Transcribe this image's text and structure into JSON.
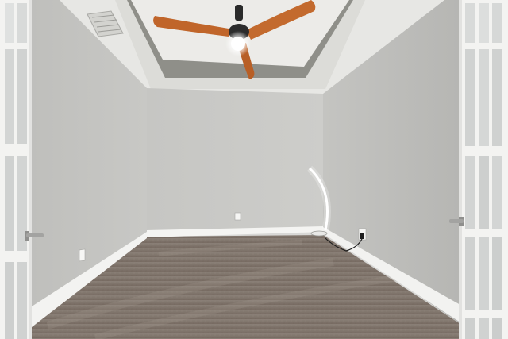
{
  "scene": {
    "subject": "empty-room",
    "colors": {
      "wall_back": "#c9c9c6",
      "wall_left": "#c2c2bf",
      "wall_right": "#bdbdba",
      "ceiling": "#e6e6e3",
      "tray_ceiling": "#ebebe8",
      "tray_trim": "#8e8e88",
      "baseboard": "#f4f4f2",
      "carpet": "#7d7269",
      "carpet_light": "#8d8278",
      "fan_blade": "#c0652a",
      "fan_body": "#2a2a2a",
      "lamp_glow": "#ffffff",
      "door_frame": "#f3f3f1",
      "door_glass": "#dcdedd",
      "handle": "#9a9a98"
    },
    "objects": [
      "ceiling-fan",
      "floor-lamp",
      "french-door-left",
      "french-door-right",
      "air-vent",
      "wall-outlet",
      "power-adapter"
    ]
  }
}
